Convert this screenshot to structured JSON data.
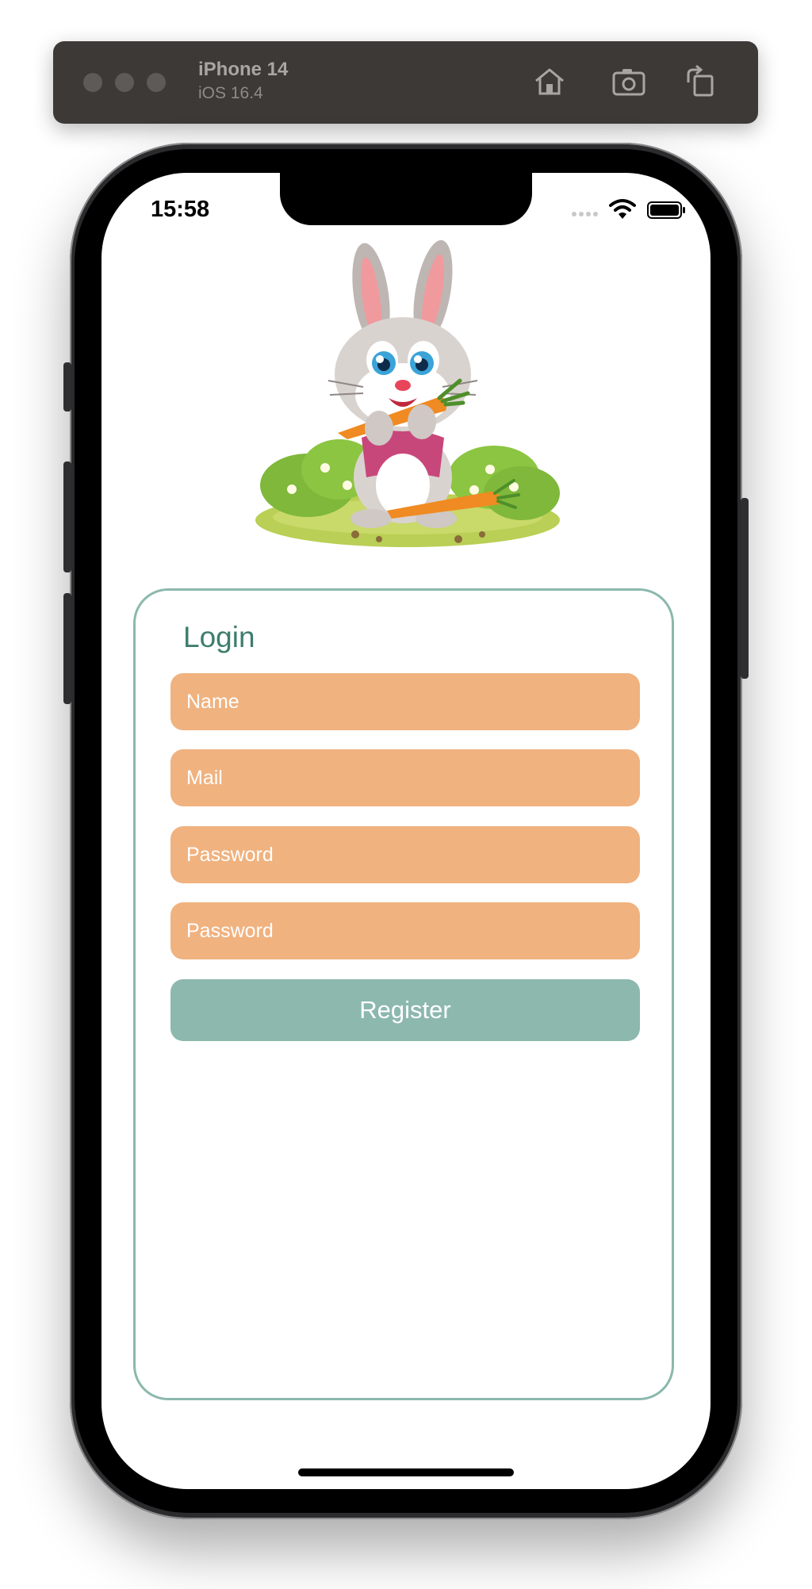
{
  "simulator": {
    "device_name": "iPhone 14",
    "os_version": "iOS 16.4",
    "buttons": [
      "home-icon",
      "screenshot-icon",
      "rotate-icon"
    ]
  },
  "status_bar": {
    "time": "15:58"
  },
  "login": {
    "title": "Login",
    "fields": [
      {
        "placeholder": "Name"
      },
      {
        "placeholder": "Mail"
      },
      {
        "placeholder": "Password"
      },
      {
        "placeholder": "Password"
      }
    ],
    "register_label": "Register"
  },
  "colors": {
    "field_background": "#f0b27f",
    "button_background": "#8cb8ae",
    "card_border": "#8bb8ad",
    "title_text": "#3e7d6d"
  }
}
